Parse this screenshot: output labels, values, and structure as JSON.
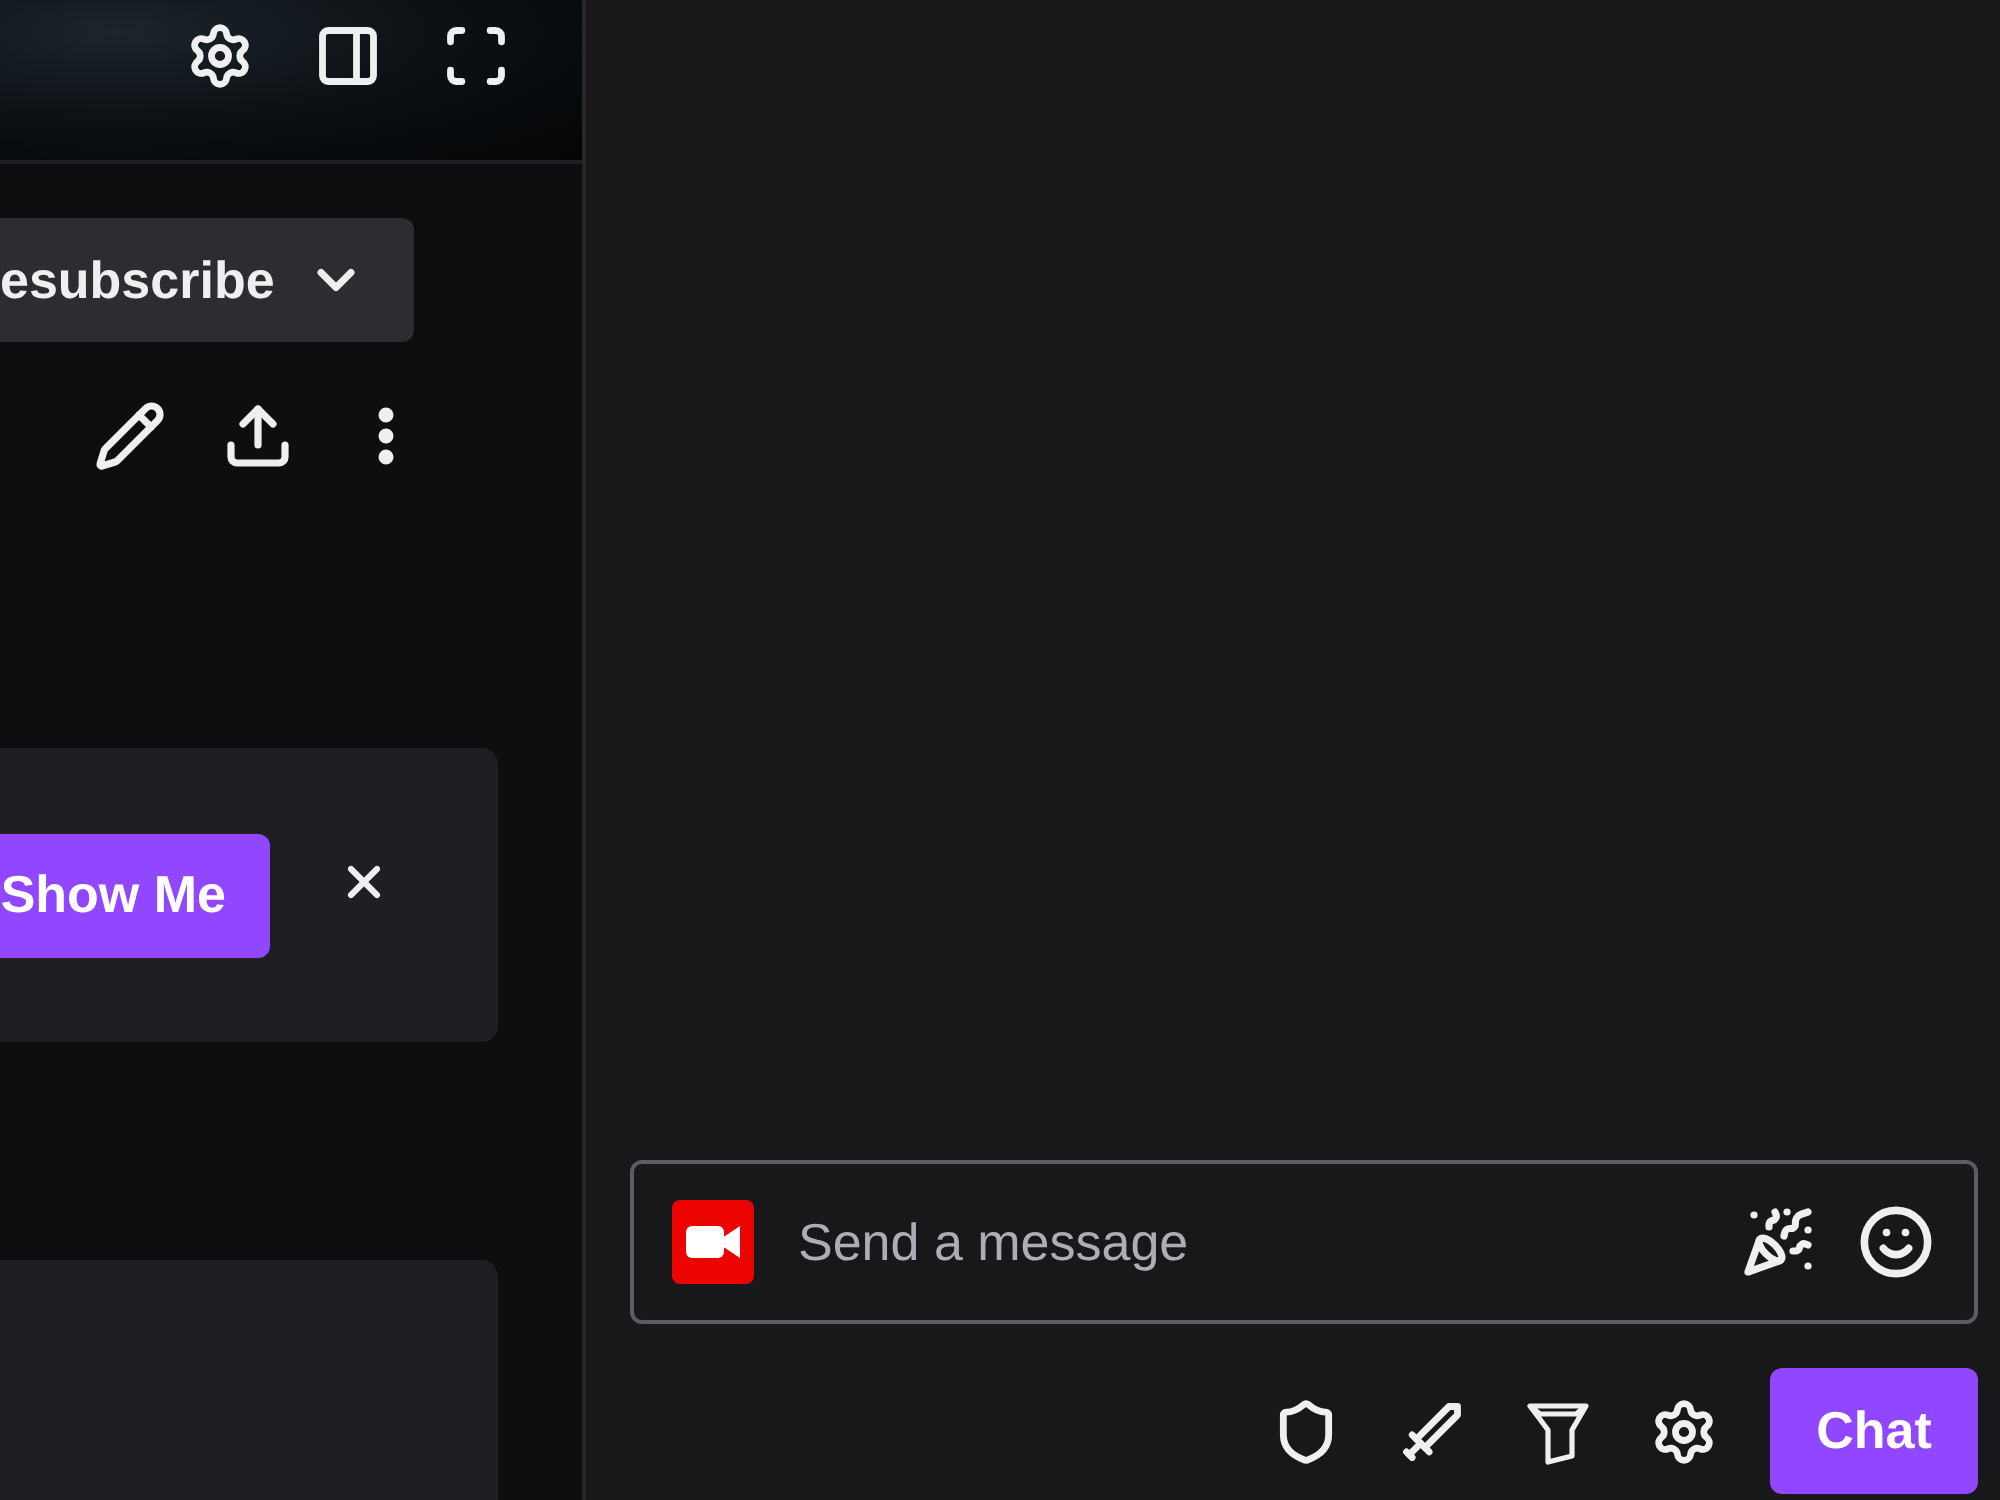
{
  "channel_actions": {
    "subscribe_button": {
      "label": "esubscribe"
    }
  },
  "notice_card": {
    "action_button": {
      "label": "Show Me"
    }
  },
  "chat": {
    "input": {
      "placeholder": "Send a message"
    },
    "send_button": {
      "label": "Chat"
    }
  }
}
